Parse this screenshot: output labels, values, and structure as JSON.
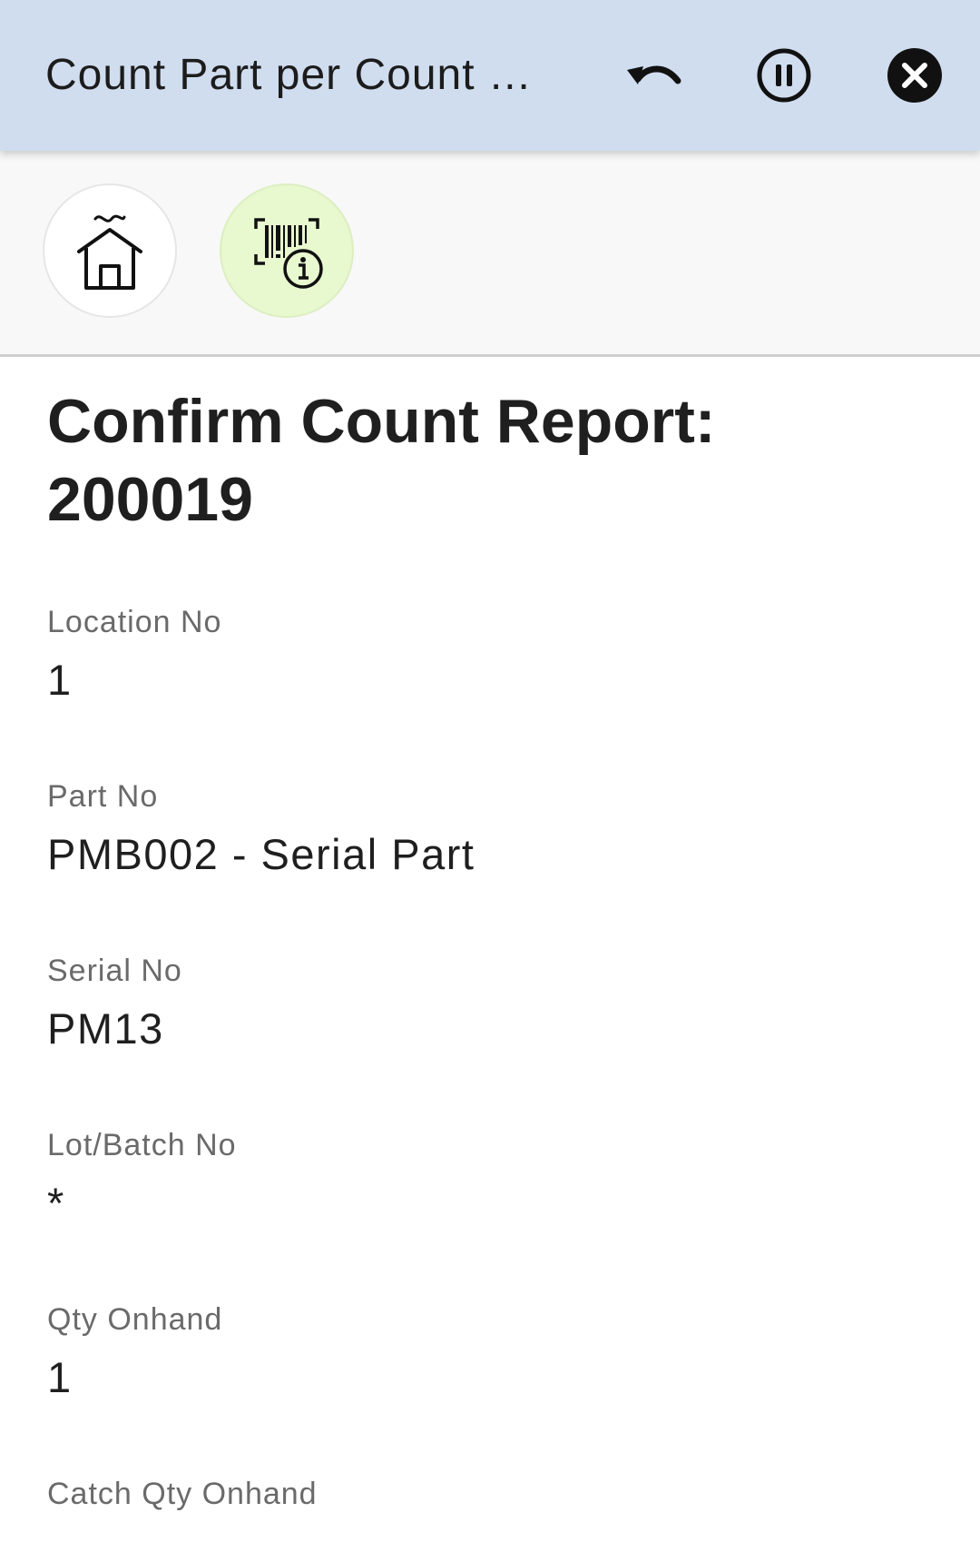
{
  "header": {
    "title": "Count Part per Count R…",
    "icons": {
      "undo": "undo-icon",
      "pause": "pause-circle-icon",
      "close": "close-circle-icon"
    },
    "background": "#d0ddef"
  },
  "toolbar": {
    "icons": {
      "home": "home-icon",
      "scan_info": "barcode-info-icon"
    },
    "scan_button_color": "#e8f8cf"
  },
  "main": {
    "title": "Confirm Count Report: 200019",
    "fields": [
      {
        "label": "Location No",
        "value": "1"
      },
      {
        "label": "Part No",
        "value": "PMB002 - Serial Part"
      },
      {
        "label": "Serial No",
        "value": "PM13"
      },
      {
        "label": "Lot/Batch No",
        "value": "*"
      },
      {
        "label": "Qty Onhand",
        "value": "1"
      },
      {
        "label": "Catch Qty Onhand",
        "value": ""
      }
    ]
  }
}
